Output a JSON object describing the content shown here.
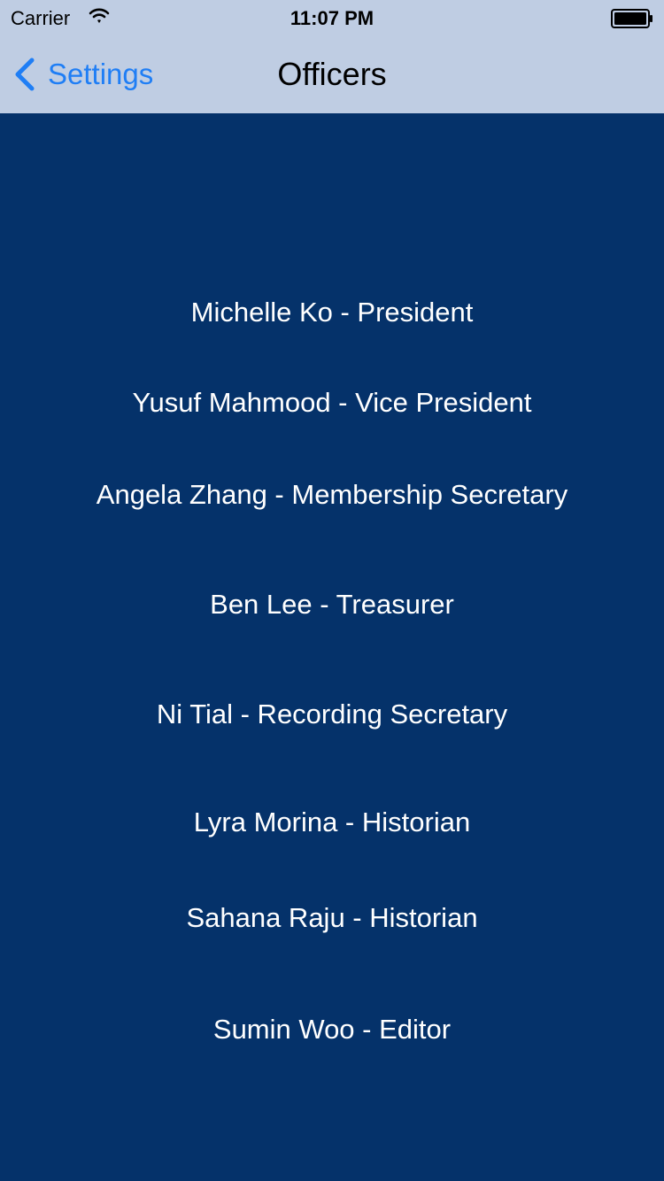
{
  "status_bar": {
    "carrier": "Carrier",
    "time": "11:07 PM",
    "wifi_icon": "wifi-icon",
    "battery_icon": "battery-icon"
  },
  "nav": {
    "back_label": "Settings",
    "back_icon": "chevron-left-icon",
    "title": "Officers"
  },
  "colors": {
    "background": "#05326a",
    "nav_bar": "#bfcde3",
    "accent": "#1f7ef5",
    "text_on_background": "#ffffff"
  },
  "officers": [
    "Michelle Ko - President",
    "Yusuf Mahmood - Vice President",
    "Angela Zhang - Membership Secretary",
    "Ben Lee - Treasurer",
    "Ni Tial - Recording Secretary",
    "Lyra Morina - Historian",
    "Sahana Raju - Historian",
    "Sumin Woo - Editor"
  ]
}
